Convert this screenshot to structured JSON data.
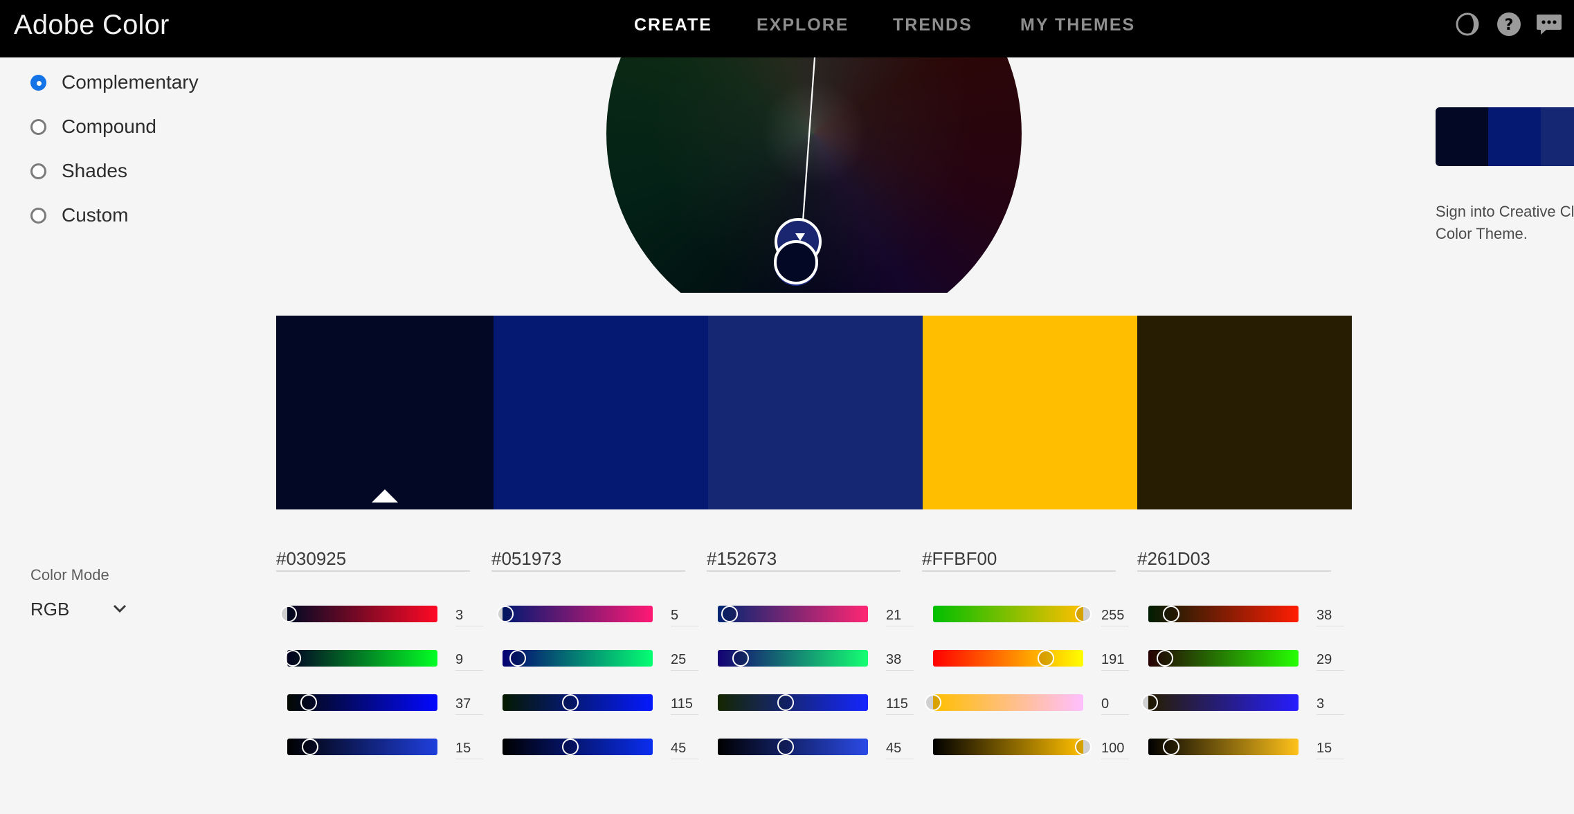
{
  "app": {
    "title": "Adobe Color"
  },
  "nav": [
    {
      "label": "CREATE",
      "active": true
    },
    {
      "label": "EXPLORE",
      "active": false
    },
    {
      "label": "TRENDS",
      "active": false
    },
    {
      "label": "MY THEMES",
      "active": false
    }
  ],
  "top_icons": [
    "theme-toggle-icon",
    "help-icon",
    "feedback-icon"
  ],
  "harmony_rules": [
    {
      "label": "Complementary",
      "selected": true
    },
    {
      "label": "Compound",
      "selected": false
    },
    {
      "label": "Shades",
      "selected": false
    },
    {
      "label": "Custom",
      "selected": false
    }
  ],
  "right_panel": {
    "signin_text_line1": "Sign into Creative Clo",
    "signin_text_line2": "Color Theme.",
    "mini_theme_colors": [
      "#030925",
      "#051973",
      "#152673"
    ]
  },
  "color_mode": {
    "label": "Color Mode",
    "value": "RGB"
  },
  "swatches": [
    {
      "hex": "#030925",
      "base": true
    },
    {
      "hex": "#051973",
      "base": false
    },
    {
      "hex": "#152673",
      "base": false
    },
    {
      "hex": "#FFBF00",
      "base": false
    },
    {
      "hex": "#261D03",
      "base": false
    }
  ],
  "columns": [
    {
      "hex": "#030925",
      "sliders": [
        {
          "value": "3",
          "level": 0.01,
          "gradient": "linear-gradient(90deg,#000925,#ff0925)"
        },
        {
          "value": "9",
          "level": 0.035,
          "gradient": "linear-gradient(90deg,#030025,#03ff25)"
        },
        {
          "value": "37",
          "level": 0.145,
          "gradient": "linear-gradient(90deg,#030900,#0309ff)"
        },
        {
          "value": "15",
          "level": 0.15,
          "gradient": "linear-gradient(90deg,#000000,#1f3fdd)"
        }
      ]
    },
    {
      "hex": "#051973",
      "sliders": [
        {
          "value": "5",
          "level": 0.02,
          "gradient": "linear-gradient(90deg,#001973,#ff1973)"
        },
        {
          "value": "25",
          "level": 0.1,
          "gradient": "linear-gradient(90deg,#050073,#05ff73)"
        },
        {
          "value": "115",
          "level": 0.45,
          "gradient": "linear-gradient(90deg,#051900,#0519ff)"
        },
        {
          "value": "45",
          "level": 0.45,
          "gradient": "linear-gradient(90deg,#000000,#0a2ef0)"
        }
      ]
    },
    {
      "hex": "#152673",
      "sliders": [
        {
          "value": "21",
          "level": 0.08,
          "gradient": "linear-gradient(90deg,#002673,#ff2673)"
        },
        {
          "value": "38",
          "level": 0.15,
          "gradient": "linear-gradient(90deg,#150073,#15ff73)"
        },
        {
          "value": "115",
          "level": 0.45,
          "gradient": "linear-gradient(90deg,#152600,#1526ff)"
        },
        {
          "value": "45",
          "level": 0.45,
          "gradient": "linear-gradient(90deg,#000000,#2a4ae6)"
        }
      ]
    },
    {
      "hex": "#FFBF00",
      "sliders": [
        {
          "value": "255",
          "level": 1.0,
          "gradient": "linear-gradient(90deg,#00bf00,#ffbf00)"
        },
        {
          "value": "191",
          "level": 0.75,
          "gradient": "linear-gradient(90deg,#ff0000,#ffff00)"
        },
        {
          "value": "0",
          "level": 0.0,
          "gradient": "linear-gradient(90deg,#ffbf00,#ffbfff)"
        },
        {
          "value": "100",
          "level": 1.0,
          "gradient": "linear-gradient(90deg,#000000,#ffbf00)"
        }
      ]
    },
    {
      "hex": "#261D03",
      "sliders": [
        {
          "value": "38",
          "level": 0.15,
          "gradient": "linear-gradient(90deg,#001d03,#ff1d03)"
        },
        {
          "value": "29",
          "level": 0.11,
          "gradient": "linear-gradient(90deg,#260003,#26ff03)"
        },
        {
          "value": "3",
          "level": 0.01,
          "gradient": "linear-gradient(90deg,#261d00,#261dff)"
        },
        {
          "value": "15",
          "level": 0.15,
          "gradient": "linear-gradient(90deg,#000000,#ffc21a)"
        }
      ]
    }
  ]
}
